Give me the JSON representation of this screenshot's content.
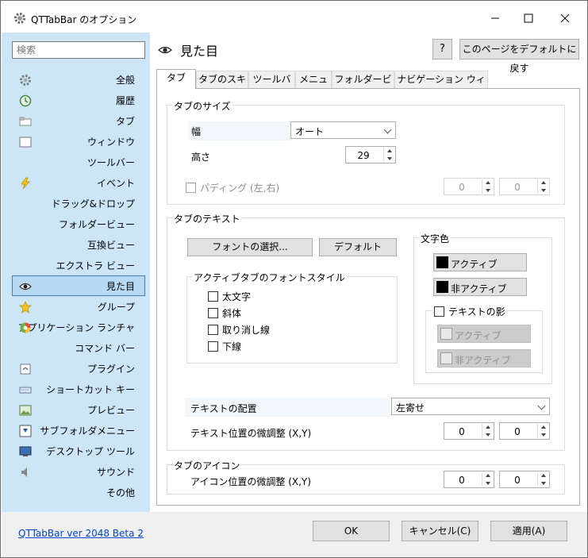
{
  "window": {
    "title": "QTTabBar のオプション"
  },
  "sidebar": {
    "search_placeholder": "検索",
    "items": [
      {
        "label": "全般",
        "icon": "gear-icon"
      },
      {
        "label": "履歴",
        "icon": "history-icon"
      },
      {
        "label": "タブ",
        "icon": "tab-icon"
      },
      {
        "label": "ウィンドウ",
        "icon": "window-icon"
      },
      {
        "label": "ツールバー",
        "icon": ""
      },
      {
        "label": "イベント",
        "icon": "lightning-icon"
      },
      {
        "label": "ドラッグ&ドロップ",
        "icon": ""
      },
      {
        "label": "フォルダービュー",
        "icon": ""
      },
      {
        "label": "互換ビュー",
        "icon": ""
      },
      {
        "label": "エクストラ ビュー",
        "icon": ""
      },
      {
        "label": "見た目",
        "icon": "eye-icon",
        "active": true
      },
      {
        "label": "グループ",
        "icon": "star-icon"
      },
      {
        "label": "アプリケーション ランチャ",
        "icon": "launcher-icon"
      },
      {
        "label": "コマンド バー",
        "icon": ""
      },
      {
        "label": "プラグイン",
        "icon": "plugin-icon"
      },
      {
        "label": "ショートカット キー",
        "icon": "keyboard-icon"
      },
      {
        "label": "プレビュー",
        "icon": "preview-icon"
      },
      {
        "label": "サブフォルダメニュー",
        "icon": "subfolder-icon"
      },
      {
        "label": "デスクトップ ツール",
        "icon": "desktop-icon"
      },
      {
        "label": "サウンド",
        "icon": "speaker-icon"
      },
      {
        "label": "その他",
        "icon": ""
      }
    ]
  },
  "header": {
    "title": "見た目",
    "help_label": "?",
    "reset_label": "このページをデフォルトに戻す"
  },
  "tabs": [
    {
      "label": "タブ",
      "active": true
    },
    {
      "label": "タブのスキン"
    },
    {
      "label": "ツールバー"
    },
    {
      "label": "メニュー"
    },
    {
      "label": "フォルダービュー"
    },
    {
      "label": "ナビゲーション ウィンドウ"
    }
  ],
  "tab_size": {
    "group_label": "タブのサイズ",
    "width_label": "幅",
    "width_value": "オート",
    "height_label": "高さ",
    "height_value": "29",
    "padding_label": "パディング (左,右)",
    "padding_left": "0",
    "padding_right": "0"
  },
  "tab_text": {
    "group_label": "タブのテキスト",
    "font_button": "フォントの選択...",
    "default_button": "デフォルト",
    "active_style_label": "アクティブタブのフォントスタイル",
    "bold": "太文字",
    "italic": "斜体",
    "strike": "取り消し線",
    "underline": "下線",
    "text_color_label": "文字色",
    "active_color": "アクティブ",
    "inactive_color": "非アクティブ",
    "shadow_label": "テキストの影",
    "shadow_active": "アクティブ",
    "shadow_inactive": "非アクティブ",
    "align_label": "テキストの配置",
    "align_value": "左寄せ",
    "offset_label": "テキスト位置の微調整 (X,Y)",
    "offset_x": "0",
    "offset_y": "0"
  },
  "tab_icon": {
    "group_label": "タブのアイコン",
    "offset_label": "アイコン位置の微調整 (X,Y)",
    "offset_x": "0",
    "offset_y": "0"
  },
  "footer": {
    "version": "QTTabBar ver 2048 Beta 2",
    "ok": "OK",
    "cancel": "キャンセル(C)",
    "apply": "適用(A)"
  },
  "colors": {
    "sidebar_bg": "#cde6f7",
    "active_item": "#b7d9f3",
    "link": "#0044cc"
  }
}
